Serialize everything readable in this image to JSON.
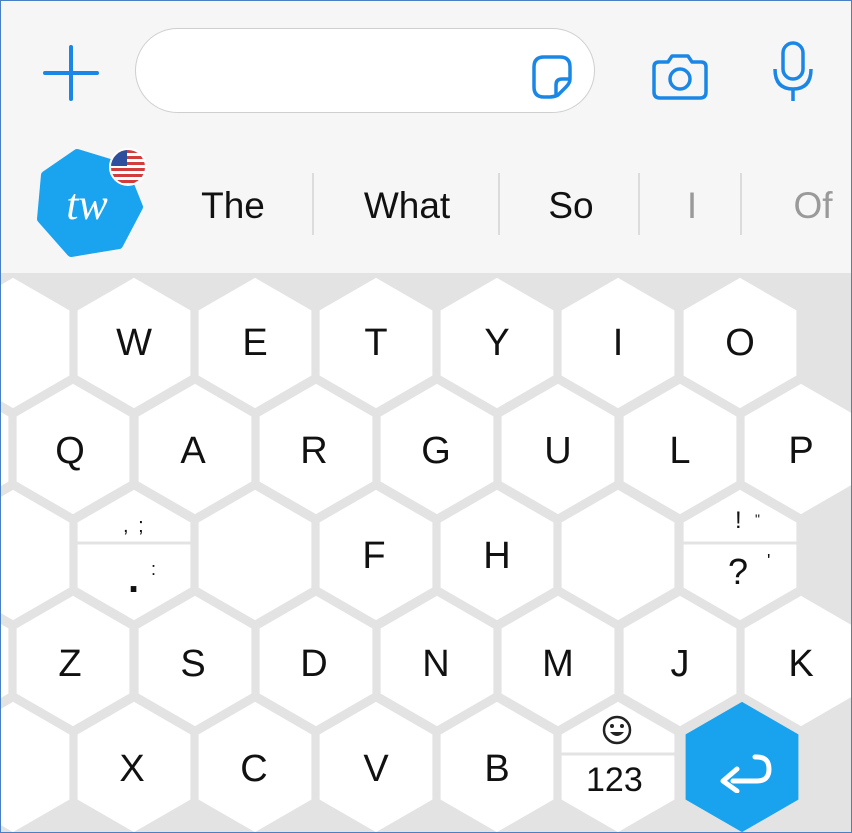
{
  "input_bar": {
    "text_value": "",
    "icons": [
      "plus-icon",
      "sticker-icon",
      "camera-icon",
      "microphone-icon"
    ],
    "accent_color": "#1a87e6"
  },
  "suggestions": {
    "logo_text": "tw",
    "logo_color": "#1aa3ef",
    "language_flag": "us-flag",
    "words": [
      "The",
      "What",
      "So",
      "I",
      "Of"
    ]
  },
  "keyboard": {
    "rows": [
      [
        "W",
        "E",
        "T",
        "Y",
        "I",
        "O"
      ],
      [
        "Q",
        "A",
        "R",
        "G",
        "U",
        "L",
        "P"
      ],
      [
        "F",
        "H"
      ],
      [
        "Z",
        "S",
        "D",
        "N",
        "M",
        "J",
        "K"
      ],
      [
        "X",
        "C",
        "V",
        "B"
      ]
    ],
    "punct_left": {
      "top": ", ;",
      "bottom_dot": ".",
      "bottom_colon": ":"
    },
    "punct_right": {
      "top_excl": "!",
      "top_quote": "\"",
      "bottom_q": "?",
      "bottom_apos": "'"
    },
    "numbers_key": "123",
    "emoji_key": "emoji-icon",
    "enter_key": "return-icon",
    "enter_color": "#19a3ee"
  }
}
